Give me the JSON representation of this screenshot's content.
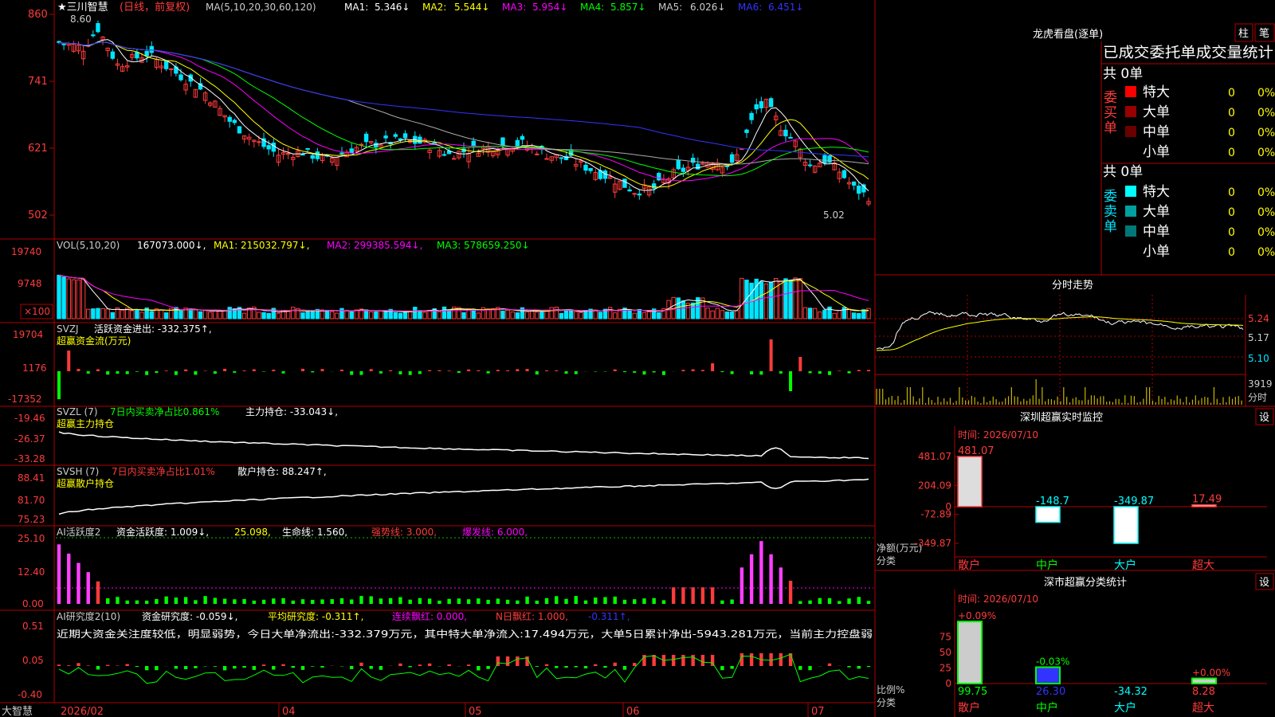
{
  "colors": {
    "up": "#ff3b3b",
    "down": "#00e5ff",
    "cyan": "#00ffff",
    "white": "#ffffff",
    "yellow": "#ffff00",
    "magenta": "#ff00ff",
    "green": "#00ff00",
    "grey": "#aaaaaa",
    "blue": "#3333ff",
    "red": "#ff0000",
    "frame": "#b00000",
    "pink": "#ff40ff"
  },
  "header": {
    "name": "★三川智慧",
    "period": "(日线，前复权)",
    "ma_label": "MA(5,10,20,30,60,120)",
    "ma": [
      {
        "label": "MA1:",
        "value": "5.346↓"
      },
      {
        "label": "MA2:",
        "value": "5.544↓"
      },
      {
        "label": "MA3:",
        "value": "5.954↓"
      },
      {
        "label": "MA4:",
        "value": "5.857↓"
      },
      {
        "label": "MA5:",
        "value": "6.026↓"
      },
      {
        "label": "MA6:",
        "value": "6.451↓"
      }
    ]
  },
  "price_panel": {
    "yticks": [
      "860",
      "741",
      "621",
      "502"
    ],
    "high_label": "8.60",
    "low_label": "5.02"
  },
  "vol_panel": {
    "yticks": [
      "19740",
      "9748",
      "×100"
    ],
    "title": "VOL(5,10,20)",
    "value": "167073.000↓,",
    "ma": [
      {
        "label": "MA1:",
        "value": "215032.797↓,"
      },
      {
        "label": "MA2:",
        "value": "299385.594↓,"
      },
      {
        "label": "MA3:",
        "value": "578659.250↓"
      }
    ]
  },
  "svzj_panel": {
    "yticks": [
      "19704",
      "1176",
      "-17352"
    ],
    "title": "SVZJ",
    "line1": "活跃资金进出: -332.375↑,",
    "line2": "超赢资金流(万元)"
  },
  "svzl_panel": {
    "yticks": [
      "-19.46",
      "-26.37",
      "-33.28"
    ],
    "title": "SVZL (7)",
    "ratio": "7日内买卖净占比0.861%",
    "value": "主力持仓: -33.043↓,",
    "line2": "超赢主力持仓"
  },
  "svsh_panel": {
    "yticks": [
      "88.41",
      "81.70",
      "75.23"
    ],
    "title": "SVSH (7)",
    "ratio": "7日内买卖净占比1.01%",
    "value": "散户持仓: 88.247↑,",
    "line2": "超赢散户持仓"
  },
  "ai1_panel": {
    "yticks": [
      "25.10",
      "12.40",
      "0.00"
    ],
    "title": "AI活跃度2",
    "v1": "资金活跃度: 1.009↓,",
    "v2": "25.098,",
    "v3": "生命线: 1.560,",
    "v4": "强势线: 3.000,",
    "v5": "爆发线: 6.000,"
  },
  "ai2_panel": {
    "yticks": [
      "0.51",
      "0.05",
      "-0.40"
    ],
    "title": "AI研究度2(10)",
    "v1": "资金研究度: -0.059↓,",
    "v2": "平均研究度: -0.311↑,",
    "v3": "连续飘红: 0.000,",
    "v4": "N日飘红: 1.000,",
    "v5": "-0.311↑,",
    "note": "近期大资金关注度较低，明显弱势，今日大单净流出:-332.379万元，其中特大单净流入:17.494万元，大单5日累计净出-5943.281万元，当前主力控盘弱"
  },
  "xaxis": {
    "brand": "大智慧",
    "labels": [
      "2026/02",
      "04",
      "05",
      "06",
      "07"
    ]
  },
  "right": {
    "lhb": {
      "title": "龙虎看盘(逐单)",
      "tab1": "柱",
      "tab2": "笔",
      "subtitle": "已成交委托单成交量统计",
      "buy_label": "委买单",
      "sell_label": "委卖单",
      "buy_total": "共 0单",
      "sell_total": "共 0单",
      "rows_buy": [
        {
          "name": "特大",
          "count": "0",
          "pct": "0%",
          "color": "#ff0000"
        },
        {
          "name": "大单",
          "count": "0",
          "pct": "0%",
          "color": "#990000"
        },
        {
          "name": "中单",
          "count": "0",
          "pct": "0%",
          "color": "#6a0000"
        },
        {
          "name": "小单",
          "count": "0",
          "pct": "0%",
          "color": "#000000"
        }
      ],
      "rows_sell": [
        {
          "name": "特大",
          "count": "0",
          "pct": "0%",
          "color": "#00ffff"
        },
        {
          "name": "大单",
          "count": "0",
          "pct": "0%",
          "color": "#00a0a0"
        },
        {
          "name": "中单",
          "count": "0",
          "pct": "0%",
          "color": "#007878"
        },
        {
          "name": "小单",
          "count": "0",
          "pct": "0%",
          "color": "#000000"
        }
      ]
    },
    "intraday": {
      "title": "分时走势",
      "yticks": [
        "5.24",
        "5.17",
        "5.10"
      ],
      "vol_label": "3919",
      "vol_unit": "分时"
    },
    "monitor": {
      "title": "深圳超赢实时监控",
      "button": "设",
      "time": "时间: 2026/07/10",
      "yticks": [
        "481.07",
        "204.09",
        "0",
        "-72.89",
        "-349.87"
      ],
      "ylabel": "净额(万元)",
      "xlabel": "分类",
      "categories": [
        "散户",
        "中户",
        "大户",
        "超大"
      ],
      "values": [
        481.07,
        -148.7,
        -349.87,
        17.49
      ],
      "value_labels": [
        "481.07",
        "-148.7",
        "-349.87",
        "17.49"
      ]
    },
    "classify": {
      "title": "深市超赢分类统计",
      "button": "设",
      "time": "时间: 2026/07/10",
      "yticks": [
        "75",
        "50",
        "25",
        "0"
      ],
      "ylabel": "比例%",
      "xlabel": "分类",
      "categories": [
        "散户",
        "中户",
        "大户",
        "超大"
      ],
      "top_labels": [
        "+0.09%",
        "-0.03%",
        "",
        "+0.00%"
      ],
      "bottom_labels": [
        "99.75",
        "26.30",
        "-34.32",
        "8.28"
      ],
      "values": [
        99.75,
        26.3,
        -34.32,
        8.28
      ]
    }
  },
  "chart_data": [
    {
      "type": "candlestick",
      "title": "三川智慧 (日线，前复权)",
      "y_ticks": [
        8.6,
        7.41,
        6.21,
        5.02
      ],
      "x_labels": [
        "2026/02",
        "04",
        "05",
        "06",
        "07"
      ],
      "high": 8.6,
      "low": 5.02,
      "ma": {
        "MA1": 5.346,
        "MA2": 5.544,
        "MA3": 5.954,
        "MA4": 5.857,
        "MA5": 6.026,
        "MA6": 6.451
      }
    },
    {
      "type": "bar",
      "title": "深圳超赢实时监控",
      "ylabel": "净额(万元)",
      "categories": [
        "散户",
        "中户",
        "大户",
        "超大"
      ],
      "values": [
        481.07,
        -148.7,
        -349.87,
        17.49
      ]
    },
    {
      "type": "bar",
      "title": "深市超赢分类统计",
      "ylabel": "比例%",
      "categories": [
        "散户",
        "中户",
        "大户",
        "超大"
      ],
      "values": [
        99.75,
        26.3,
        -34.32,
        8.28
      ]
    }
  ]
}
